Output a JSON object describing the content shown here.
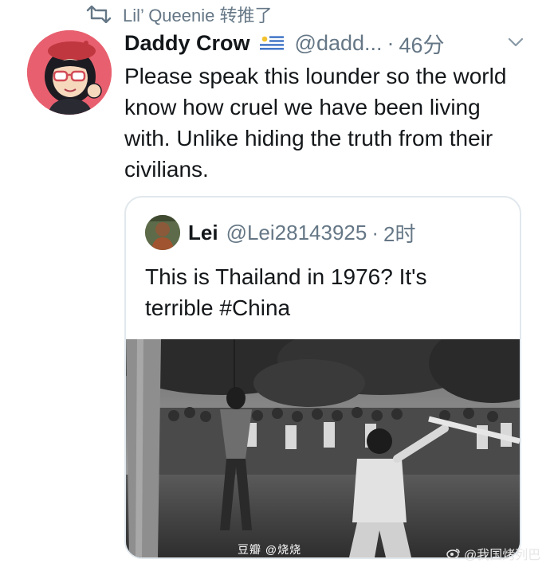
{
  "retweet": {
    "icon": "retweet-icon",
    "text": "Lil’ Queenie 转推了"
  },
  "tweet": {
    "display_name": "Daddy Crow",
    "flag_icon": "uruguay-flag-icon",
    "handle": "@dadd...",
    "separator": "·",
    "time": "46分",
    "menu_icon": "chevron-down-icon",
    "text": "Please speak this lounder so the world know how cruel we have been living with. Unlike hiding the truth from their civilians."
  },
  "quote": {
    "display_name": "Lei",
    "handle": "@Lei28143925",
    "separator": "·",
    "time": "2时",
    "text": "This is Thailand in 1976?  It's terrible #China",
    "image_alt": "black-and-white historical photograph: a crowd watching a man swing a folding chair at a figure hanging from a tree"
  },
  "watermarks": {
    "left": "豆瓣  @烧烧",
    "right": "@我国烤列巴"
  },
  "colors": {
    "text": "#14171a",
    "muted": "#657786",
    "border": "#e1e8ed",
    "avatar_bg": "#e8606f"
  }
}
